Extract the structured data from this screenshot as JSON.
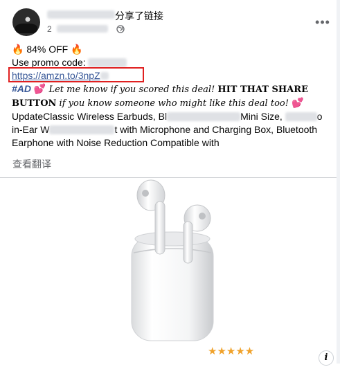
{
  "header": {
    "shared_text": "分享了链接",
    "date_text": "2",
    "more_label": "•••"
  },
  "post": {
    "deal_line": "🔥 84% OFF 🔥",
    "promo_label": "Use promo code:",
    "link_text": "https://amzn.to/3npZ",
    "hashtag": "#AD",
    "heart": "💕",
    "line3_italic": " Let me know if you scored this deal! ",
    "line3_bold": "HIT THAT SHARE",
    "line4_bold": "BUTTON",
    "line4_italic": " if you know someone who might like this deal too! ",
    "line5_start": "UpdateClassic Wireless Earbuds, Bl",
    "line5_end": "Mini Size,",
    "line5_tail": "o",
    "line6_start": "in-Ear W",
    "line6_end": "t with Microphone and Charging Box, Bluetooth",
    "line7": "Earphone with Noise Reduction Compatible with",
    "translate_label": "查看翻译"
  },
  "image": {
    "rating_stars": "★★★★★",
    "info_label": "i"
  }
}
